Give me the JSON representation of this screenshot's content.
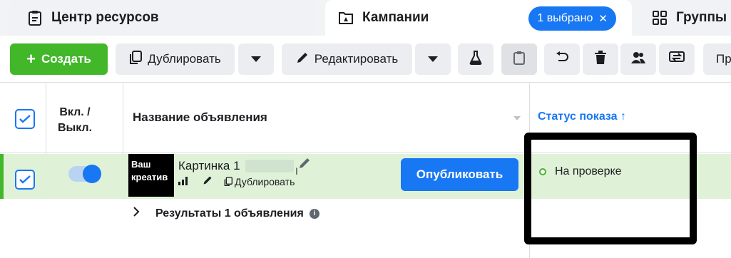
{
  "tabs": {
    "resources": "Центр ресурсов",
    "campaigns": "Кампании",
    "selected_badge": "1 выбрано",
    "groups": "Группы"
  },
  "toolbar": {
    "create": "Создать",
    "duplicate": "Дублировать",
    "edit": "Редактировать",
    "more_truncated": "Пр"
  },
  "table": {
    "col_onoff": "Вкл. / Выкл.",
    "col_name": "Название объявления",
    "col_status": "Статус показа ↑"
  },
  "row": {
    "creative_label": "Ваш креатив",
    "ad_name": "Картинка 1",
    "duplicate": "Дублировать",
    "publish": "Опубликовать",
    "status": "На проверке",
    "toggle_on": true
  },
  "results": {
    "label": "Результаты 1 объявления"
  },
  "colors": {
    "accent": "#1877f2",
    "create_green": "#42b72a",
    "row_bg": "#dff2d8"
  }
}
